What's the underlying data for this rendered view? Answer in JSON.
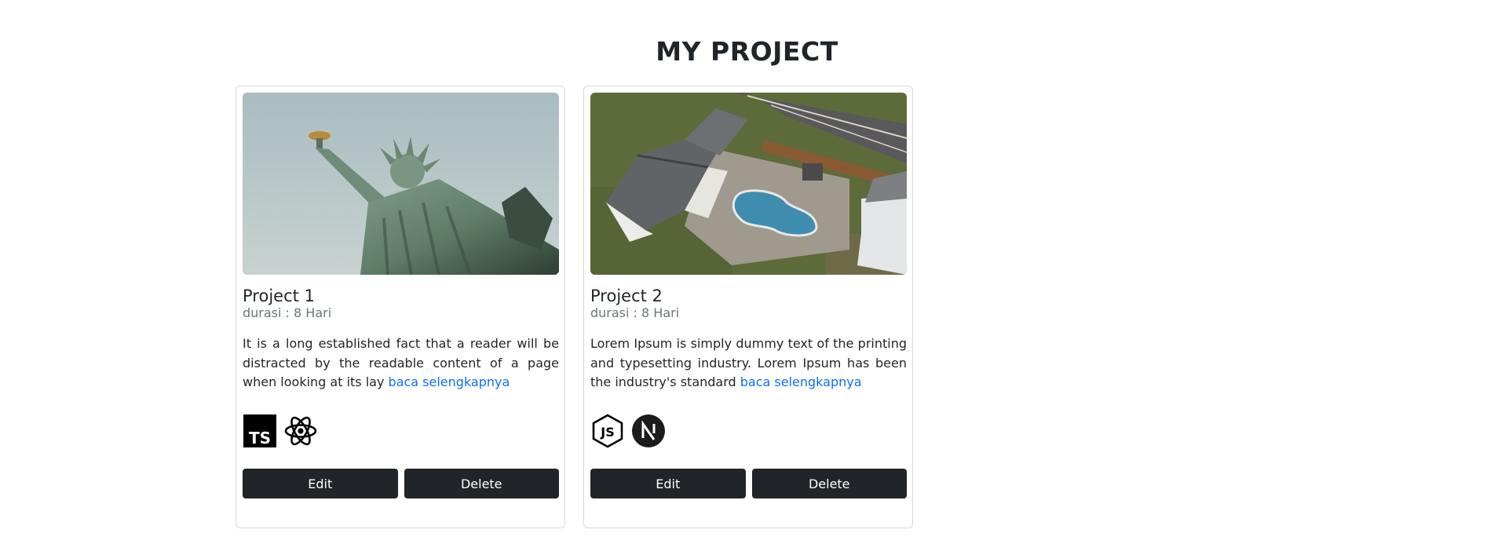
{
  "header": {
    "title": "MY PROJECT"
  },
  "projects": [
    {
      "title": "Project 1",
      "duration": "durasi : 8 Hari",
      "description": "It is a long established fact that a reader will be distracted by the readable content of a page when looking at its lay",
      "read_more": "baca selengkapnya",
      "image": "statue-of-liberty-photo",
      "tech_icons": [
        "typescript-icon",
        "react-icon"
      ],
      "edit_label": "Edit",
      "delete_label": "Delete"
    },
    {
      "title": "Project 2",
      "duration": "durasi : 8 Hari",
      "description": "Lorem Ipsum is simply dummy text of the printing and typesetting industry. Lorem Ipsum has been the industry's standard",
      "read_more": "baca selengkapnya",
      "image": "aerial-house-pool-photo",
      "tech_icons": [
        "nodejs-icon",
        "nextjs-icon"
      ],
      "edit_label": "Edit",
      "delete_label": "Delete"
    }
  ],
  "colors": {
    "button_bg": "#212529",
    "link": "#0d6efd",
    "muted_text": "#6c757d",
    "card_border": "#d6d8db"
  }
}
